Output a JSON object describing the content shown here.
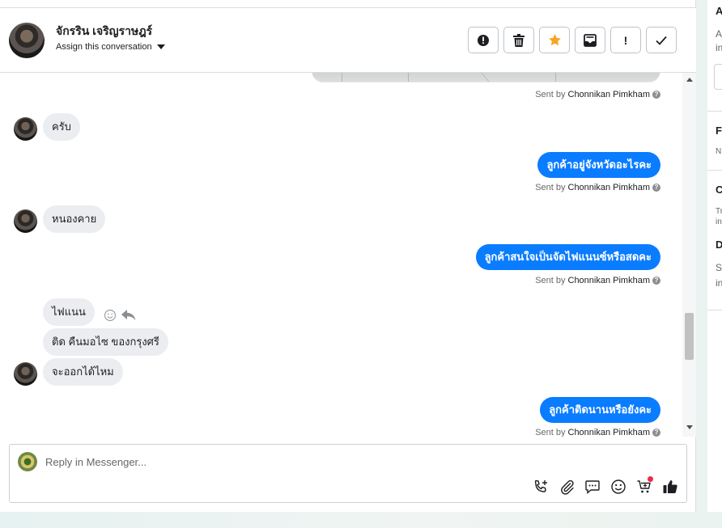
{
  "contact": {
    "name": "จักรริน เจริญราษฎร์",
    "assign_label": "Assign this conversation"
  },
  "header_actions": [
    {
      "name": "spam-button",
      "icon": "alert-circle-icon"
    },
    {
      "name": "delete-button",
      "icon": "trash-icon"
    },
    {
      "name": "star-button",
      "icon": "star-icon"
    },
    {
      "name": "mark-unread-button",
      "icon": "envelope-icon"
    },
    {
      "name": "follow-up-button",
      "icon": "exclamation-icon",
      "label": "!"
    },
    {
      "name": "done-button",
      "icon": "check-icon"
    }
  ],
  "messages": {
    "sent_by_prefix": "Sent by",
    "agent": "Chonnikan Pimkham",
    "help_glyph": "?",
    "in_1": "ครับ",
    "out_1": "ลูกค้าอยู่จังหวัดอะไรคะ",
    "in_2": "หนองคาย",
    "out_2": "ลูกค้าสนใจเป็นจัดไฟแนนซ์หรือสดคะ",
    "in_3a": "ไฟแนน",
    "in_3b": "ติด คืนมอไซ ของกรุงศรี",
    "in_3c": "จะออกได้ไหม",
    "out_3": "ลูกค้าติดนานหรือยังคะ"
  },
  "reply": {
    "placeholder": "Reply in Messenger..."
  },
  "right_panel": {
    "s1_head": "A",
    "s1_l1": "A",
    "s1_l2": "in",
    "s2_head": "F",
    "s2_l1": "N",
    "s3_head": "C",
    "s3_l1": "Tr",
    "s3_l2": "in",
    "s4_head": "D",
    "s4_l1": "Sl",
    "s4_l2": "in"
  },
  "colors": {
    "outgoing_bubble": "#0a7cff",
    "incoming_bubble": "#ebedf0",
    "star": "#f5a623",
    "notification_dot": "#f02849"
  }
}
